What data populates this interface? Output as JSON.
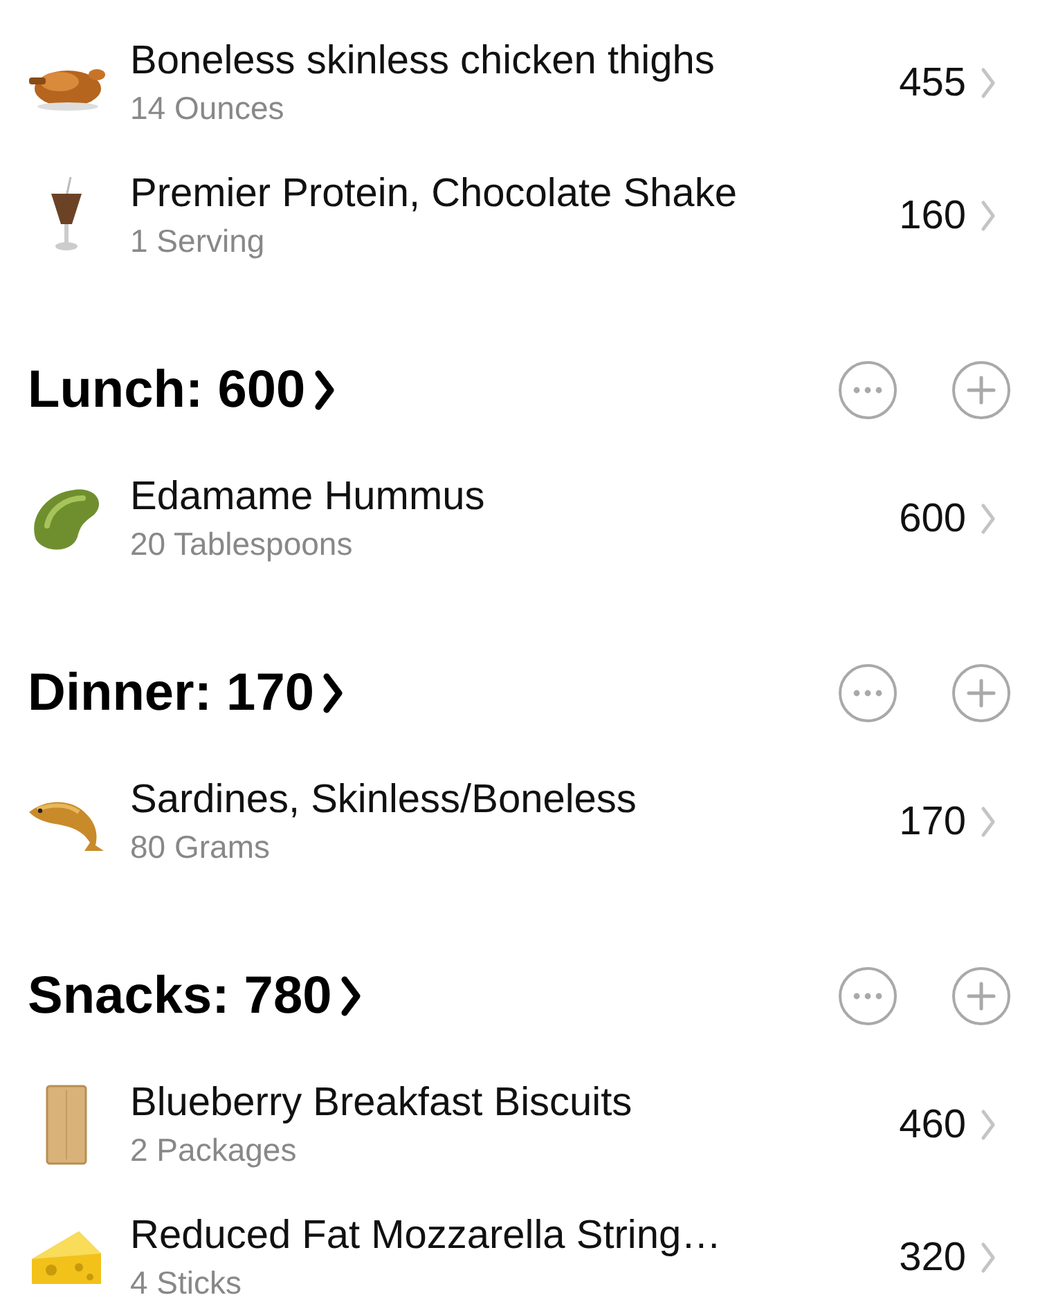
{
  "sections": [
    {
      "items": [
        {
          "kind": "drumstick",
          "name": "Boneless skinless chicken thighs",
          "amount": "14 Ounces",
          "calories": "455"
        },
        {
          "kind": "shake",
          "name": "Premier Protein, Chocolate Shake",
          "amount": "1 Serving",
          "calories": "160"
        }
      ]
    },
    {
      "title": "Lunch: 600",
      "items": [
        {
          "kind": "bean",
          "name": "Edamame Hummus",
          "amount": "20 Tablespoons",
          "calories": "600"
        }
      ]
    },
    {
      "title": "Dinner: 170",
      "items": [
        {
          "kind": "fish",
          "name": "Sardines, Skinless/Boneless",
          "amount": "80 Grams",
          "calories": "170"
        }
      ]
    },
    {
      "title": "Snacks: 780",
      "items": [
        {
          "kind": "biscuit",
          "name": "Blueberry Breakfast Biscuits",
          "amount": "2 Packages",
          "calories": "460"
        },
        {
          "kind": "cheese",
          "name": "Reduced Fat Mozzarella String…",
          "amount": "4 Sticks",
          "calories": "320"
        }
      ]
    }
  ]
}
